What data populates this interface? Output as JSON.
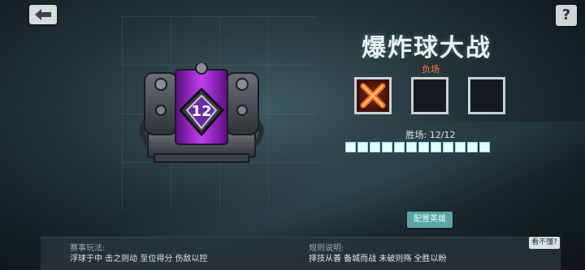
{
  "header": {
    "back_icon": "arrow-left-icon",
    "help_label": "?"
  },
  "event": {
    "title": "爆炸球大战",
    "chest_level": "12",
    "lose_label": "负场",
    "losses": [
      true,
      false,
      false
    ],
    "win_label": "胜场: 12/12",
    "wins": 12,
    "wins_total": 12,
    "config_button": "配置英雄"
  },
  "bottom": {
    "gameplay_title": "赛事玩法:",
    "gameplay_text": "浮球于中 击之则动 至位得分 伤敌以控",
    "rules_title": "规则说明:",
    "rules_text": "择技从善 备城而战 未破则殇 全胜以盼",
    "help_tag": "看不懂?"
  },
  "colors": {
    "accent": "#58a7a4",
    "lose_red": "#ff7a4a",
    "chest_purple": "#a020d0"
  }
}
